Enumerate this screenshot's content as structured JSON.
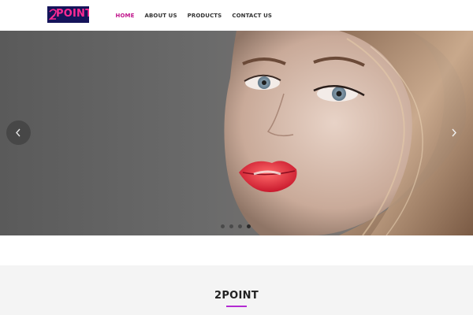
{
  "brand": {
    "logo_text": "POINT",
    "logo_mark": "2",
    "accent_color": "#c0158c",
    "logo_bg": "#15145a",
    "logo_color": "#ff2a93"
  },
  "nav": {
    "items": [
      {
        "label": "HOME",
        "active": true
      },
      {
        "label": "ABOUT US",
        "active": false
      },
      {
        "label": "PRODUCTS",
        "active": false
      },
      {
        "label": "CONTACT US",
        "active": false
      }
    ]
  },
  "hero": {
    "prev_icon": "chevron-left-icon",
    "next_icon": "chevron-right-icon",
    "slide_count": 4,
    "active_slide": 4
  },
  "section": {
    "title": "2POINT",
    "underline_color": "#b32bd2"
  }
}
